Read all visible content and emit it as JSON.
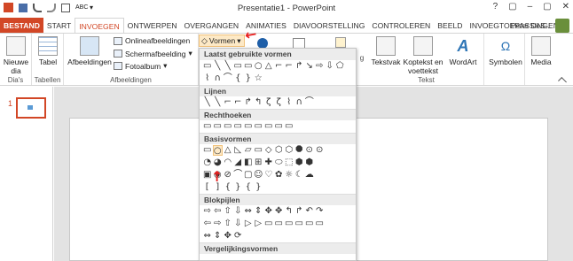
{
  "window": {
    "title": "Presentatie1 - PowerPoint",
    "controls": [
      "?",
      "▢",
      "–",
      "▢",
      "✕"
    ],
    "user": "Peter DeS..."
  },
  "tabs": [
    "BESTAND",
    "START",
    "INVOEGEN",
    "ONTWERPEN",
    "OVERGANGEN",
    "ANIMATIES",
    "DIAVOORSTELLING",
    "CONTROLEREN",
    "BEELD",
    "INVOEGTOEPASSINGEN"
  ],
  "ribbon": {
    "new_slide": "Nieuwe dia",
    "table": "Tabel",
    "pictures": "Afbeeldingen",
    "online_pictures": "Onlineafbeeldingen",
    "screenshot": "Schermafbeelding",
    "photo_album": "Fotoalbum",
    "shapes": "Vormen",
    "textbox": "Tekstvak",
    "header_footer": "Koptekst en voettekst",
    "wordart": "WordArt",
    "symbols": "Symbolen",
    "media": "Media",
    "groups": {
      "slides": "Dia's",
      "tables": "Tabellen",
      "images": "Afbeeldingen",
      "text": "Tekst"
    },
    "frag_g": "g"
  },
  "slide_pane": {
    "number": "1"
  },
  "dropdown": {
    "sections": [
      {
        "title": "Laatst gebruikte vormen",
        "rows": [
          [
            "▭",
            "╲",
            "╲",
            "▭",
            "▭",
            "○",
            "△",
            "⌐",
            "⌐",
            "↱",
            "↘",
            "⇨",
            "⇩",
            "⬠"
          ],
          [
            "⌇",
            "∩",
            "⌒",
            "{",
            "}",
            "☆"
          ]
        ]
      },
      {
        "title": "Lijnen",
        "rows": [
          [
            "╲",
            "╲",
            "⌐",
            "⌐",
            "↱",
            "↰",
            "ζ",
            "ζ",
            "⌇",
            "∩",
            "⌒"
          ]
        ]
      },
      {
        "title": "Rechthoeken",
        "rows": [
          [
            "▭",
            "▭",
            "▭",
            "▭",
            "▭",
            "▭",
            "▭",
            "▭",
            "▭"
          ]
        ]
      },
      {
        "title": "Basisvormen",
        "rows": [
          [
            "▭",
            "○",
            "△",
            "◺",
            "▱",
            "▭",
            "◇",
            "⬡",
            "⬡",
            "⯃",
            "⊙",
            "⊙"
          ],
          [
            "◔",
            "◕",
            "◠",
            "◢",
            "◧",
            "⊞",
            "✚",
            "⬭",
            "⬚",
            "⬢",
            "⬢"
          ],
          [
            "▣",
            "◉",
            "⊘",
            "⌒",
            "▢",
            "☺",
            "♡",
            "✿",
            "☼",
            "☾",
            "☁"
          ],
          [
            "[",
            "]",
            "{",
            "}",
            "{",
            "}"
          ]
        ]
      },
      {
        "title": "Blokpijlen",
        "rows": [
          [
            "⇨",
            "⇦",
            "⇧",
            "⇩",
            "⇔",
            "⇕",
            "✥",
            "✥",
            "↰",
            "↱",
            "↶",
            "↷"
          ],
          [
            "⇦",
            "⇨",
            "⇧",
            "⇩",
            "▷",
            "▷",
            "▭",
            "▭",
            "▭",
            "▭",
            "▭",
            "▭"
          ],
          [
            "⇔",
            "⇕",
            "✥",
            "⟳"
          ]
        ]
      },
      {
        "title": "Vergelijkingsvormen",
        "rows": []
      }
    ]
  }
}
